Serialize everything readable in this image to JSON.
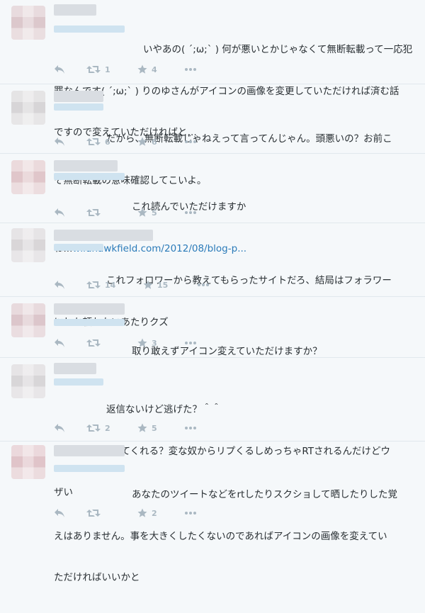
{
  "tweets": [
    {
      "text_lines": [
        "いやあの( ´;ω;` ) 何が悪いとかじゃなくて無断転載って一応犯",
        "罪なんです( ´;ω;` ) りのゆさんがアイコンの画像を変更していただければ済む話",
        "ですので変えていただければと…"
      ],
      "retweet_count": "1",
      "like_count": "4"
    },
    {
      "text_lines": [
        "だから、無断転載じゃねえって言ってんじゃん。頭悪いの？お前こ",
        "そ無断転載の意味確認してこいよ。"
      ],
      "retweet_count": "6",
      "like_count": "6"
    },
    {
      "text_lines": [
        "これ読んでいただけますか",
        "ね..."
      ],
      "link_text": "wildhawkfield.com/2012/08/blog-p...",
      "retweet_count": "",
      "like_count": "5"
    },
    {
      "text_lines": [
        "これフォロワーから教えてもらったサイトだろ、結局はフォラワー",
        "にしか頼れないあたりクズ"
      ],
      "retweet_count": "14",
      "like_count": "15"
    },
    {
      "text_lines": [
        "取り敢えずアイコン変えていただけますか？"
      ],
      "retweet_count": "",
      "like_count": "3"
    },
    {
      "text_lines": [
        "返信ないけど逃げた？＾＾",
        "あと晒すのやめてくれる？変な奴からリプくるしめっちゃRTされるんだけどウ",
        "ザい"
      ],
      "retweet_count": "2",
      "like_count": "5"
    },
    {
      "text_lines": [
        "あなたのツイートなどをrtしたりスクショして晒したりした覚",
        "えはありません。事を大きくしたくないのであればアイコンの画像を変えてい",
        "ただければいいかと"
      ],
      "retweet_count": "",
      "like_count": "2"
    }
  ],
  "icons": {
    "reply": "reply-icon",
    "retweet": "retweet-icon",
    "like": "star-icon",
    "more": "more-icon"
  },
  "colors": {
    "background": "#f5f8fa",
    "divider": "#e1e8ed",
    "text": "#292f33",
    "action_gray": "#aab8c2",
    "link": "#2b7bb9"
  }
}
